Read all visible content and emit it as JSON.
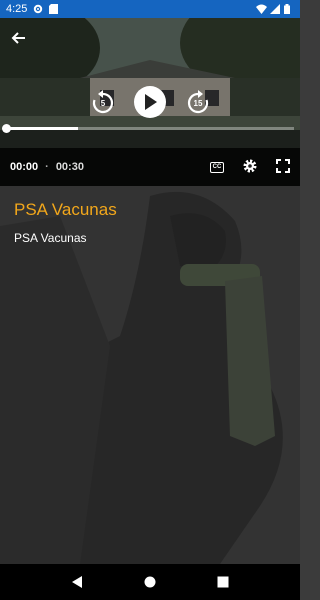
{
  "status_bar": {
    "time": "4:25",
    "color": "#1565c0"
  },
  "player": {
    "current_time": "00:00",
    "separator": "·",
    "duration": "00:30",
    "rewind_seconds": "5",
    "forward_seconds": "15",
    "progress_fraction": 0.25,
    "cc_label": "CC"
  },
  "content": {
    "title": "PSA Vacunas",
    "subtitle": "PSA Vacunas",
    "title_color": "#f2a71b"
  }
}
